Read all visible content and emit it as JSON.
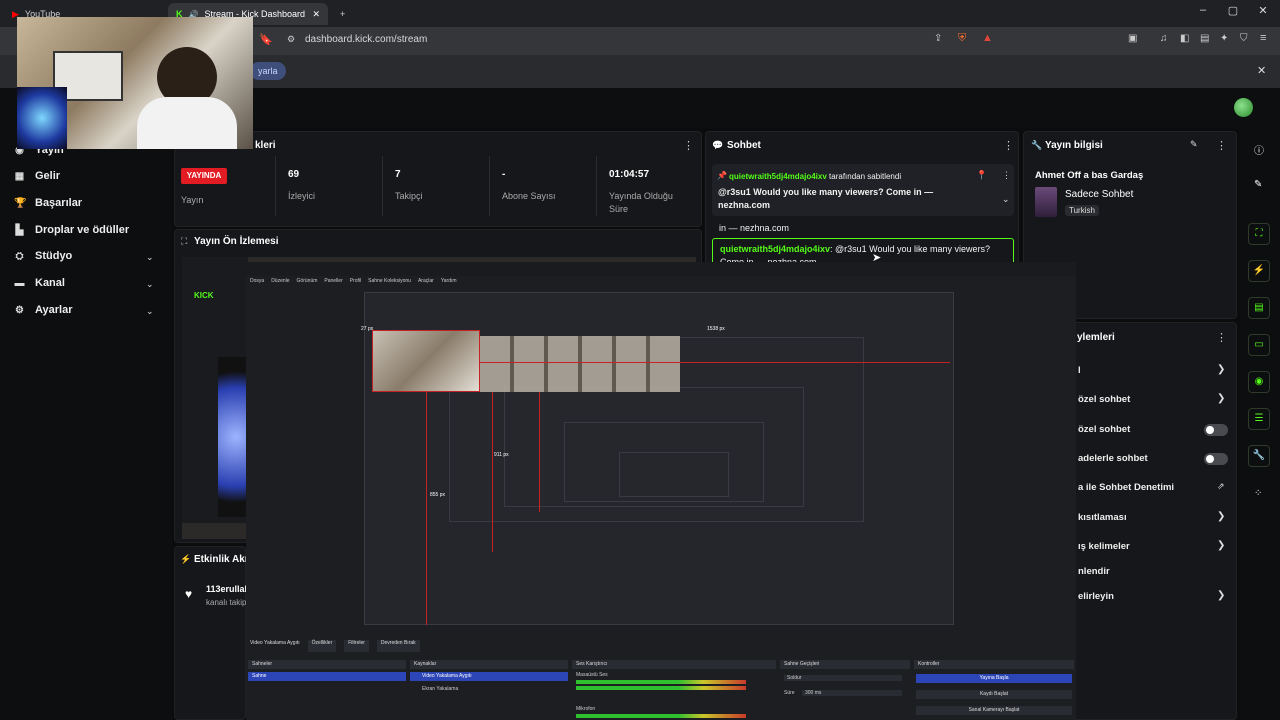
{
  "browser": {
    "tabs": [
      {
        "label": "YouTube",
        "active": false
      },
      {
        "label": "Stream - Kick Dashboard",
        "active": true
      }
    ],
    "new_tab_symbol": "+",
    "url": "dashboard.kick.com/stream",
    "infobar_chip": "yarla",
    "close_symbol": "✕"
  },
  "sidebar": {
    "items": [
      {
        "label": "Yayın",
        "icon": "broadcast-icon"
      },
      {
        "label": "Gelir",
        "icon": "revenue-icon"
      },
      {
        "label": "Başarılar",
        "icon": "trophy-icon"
      },
      {
        "label": "Droplar ve ödüller",
        "icon": "gift-icon"
      },
      {
        "label": "Stüdyo",
        "icon": "studio-icon",
        "expandable": true
      },
      {
        "label": "Kanal",
        "icon": "channel-icon",
        "expandable": true
      },
      {
        "label": "Ayarlar",
        "icon": "settings-icon",
        "expandable": true
      }
    ]
  },
  "stats_panel": {
    "title": "kleri",
    "live_badge": "YAYINDA",
    "live_label": "Yayın",
    "stats": [
      {
        "value": "69",
        "label": "İzleyici"
      },
      {
        "value": "7",
        "label": "Takipçi"
      },
      {
        "value": "-",
        "label": "Abone Sayısı"
      },
      {
        "value": "01:04:57",
        "label": "Yayında Olduğu Süre"
      }
    ]
  },
  "preview_panel": {
    "title": "Yayın Ön İzlemesi"
  },
  "activity_panel": {
    "title": "Etkinlik Akı",
    "entry_user": "113erullal",
    "entry_text": "kanalı takip"
  },
  "chat": {
    "title": "Sohbet",
    "pinned": {
      "pinned_by": "quietwraith5dj4mdajo4ixv",
      "pinned_suffix": "tarafından sabitlendi",
      "message": "@r3su1 Would you like many viewers? Come in — nezhna.com"
    },
    "overflow_line": "in — nezhna.com",
    "messages": [
      {
        "user": "quietwraith5dj4mdajo4ixv",
        "text": ": @r3su1 Would you like many viewers? Come in — nezhna.com"
      }
    ]
  },
  "stream_info": {
    "title": "Yayın bilgisi",
    "stream_title": "Ahmet Off a bas Gardaş",
    "category": "Sadece Sohbet",
    "language_tag": "Turkish"
  },
  "chat_settings": {
    "title": "ylemleri",
    "rows": [
      {
        "label": "l",
        "control": "chevron"
      },
      {
        "label": "özel sohbet",
        "control": "chevron"
      },
      {
        "label": "özel sohbet",
        "control": "toggle",
        "on": false
      },
      {
        "label": "adelerle sohbet",
        "control": "toggle",
        "on": false
      },
      {
        "label": "a ile Sohbet Denetimi",
        "control": "external"
      },
      {
        "label": "kısıtlaması",
        "control": "chevron"
      },
      {
        "label": "ış kelimeler",
        "control": "chevron"
      },
      {
        "label": "nlendir",
        "control": "none"
      },
      {
        "label": "elirleyin",
        "control": "chevron"
      }
    ]
  },
  "obs": {
    "menu": [
      "Dosya",
      "Düzenle",
      "Görünüm",
      "Paneller",
      "Profil",
      "Sahne Koleksiyonu",
      "Araçlar",
      "Yardım"
    ],
    "measure_labels": [
      "1538 px",
      "27 px",
      "855 px",
      "911 px"
    ],
    "toolbar": [
      "Video Yakalama Aygıtı",
      "Özellikler",
      "Filtreler",
      "Devreden Bırak"
    ],
    "docks": {
      "scenes": {
        "title": "Sahneler",
        "items": [
          "Sahne"
        ]
      },
      "sources": {
        "title": "Kaynaklar",
        "items": [
          "Video Yakalama Aygıtı",
          "Ekran Yakalama"
        ]
      },
      "mixer": {
        "title": "Ses Karıştırıcı",
        "channels": [
          "Masaüstü Ses",
          "Mikrofon"
        ]
      },
      "transitions": {
        "title": "Sahne Geçişleri",
        "type": "Soldur",
        "duration_label": "Süre",
        "duration": "300 ms"
      },
      "controls": {
        "title": "Kontroller",
        "buttons": [
          "Yayına Başla",
          "Kaydı Başlat",
          "Sanal Kamerayı Başlat"
        ]
      }
    }
  },
  "colors": {
    "kick_green": "#53fc18",
    "live_red": "#e31b23",
    "obs_selection_blue": "#2c46b8"
  }
}
